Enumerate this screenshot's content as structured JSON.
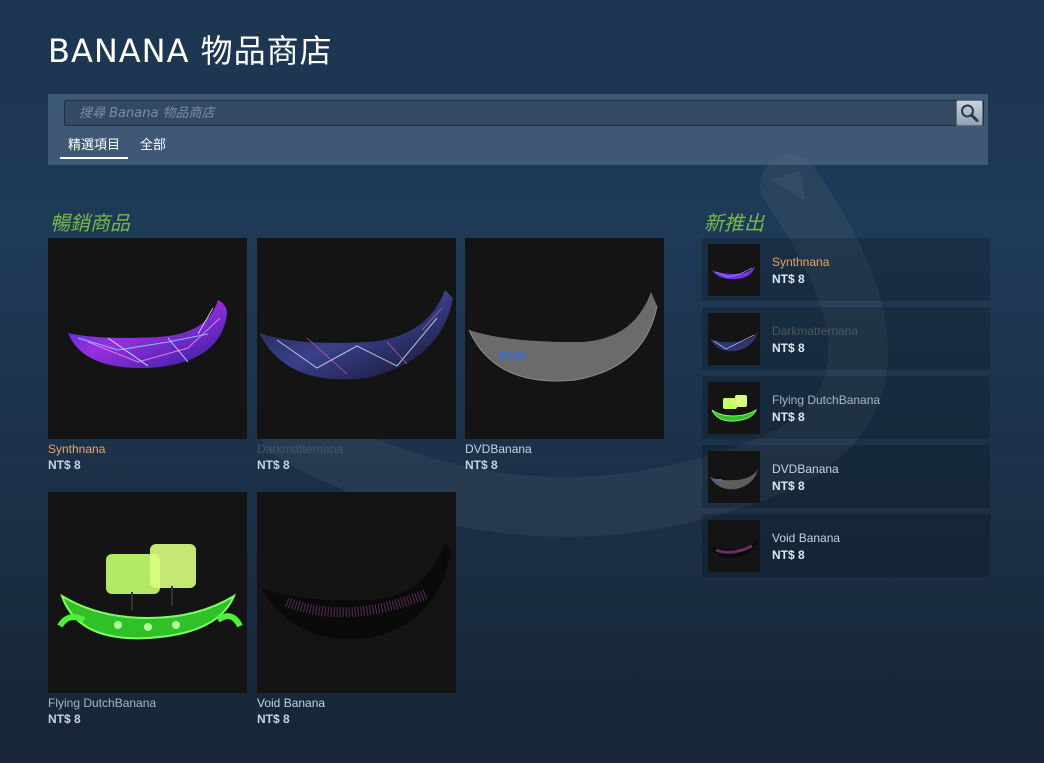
{
  "title": "BANANA 物品商店",
  "search": {
    "placeholder": "搜尋 Banana 物品商店"
  },
  "tabs": [
    {
      "label": "精選項目",
      "active": true
    },
    {
      "label": "全部",
      "active": false
    }
  ],
  "best_sellers": {
    "title": "暢銷商品",
    "items": [
      {
        "name": "Synthnana",
        "price": "NT$ 8",
        "name_color": "#e9a464",
        "icon": "synthnana-banana-image"
      },
      {
        "name": "Darkmatternana",
        "price": "NT$ 8",
        "name_color": "#4e5460",
        "icon": "darkmatternana-banana-image"
      },
      {
        "name": "DVDBanana",
        "price": "NT$ 8",
        "name_color": "#c6d4df",
        "icon": "dvd-banana-image"
      },
      {
        "name": "Flying DutchBanana",
        "price": "NT$ 8",
        "name_color": "#aab5bf",
        "icon": "flying-dutch-banana-image"
      },
      {
        "name": "Void Banana",
        "price": "NT$ 8",
        "name_color": "#bcd6ec",
        "icon": "void-banana-image"
      }
    ]
  },
  "new_releases": {
    "title": "新推出",
    "items": [
      {
        "name": "Synthnana",
        "price": "NT$ 8"
      },
      {
        "name": "Darkmatternana",
        "price": "NT$ 8"
      },
      {
        "name": "Flying DutchBanana",
        "price": "NT$ 8"
      },
      {
        "name": "DVDBanana",
        "price": "NT$ 8"
      },
      {
        "name": "Void Banana",
        "price": "NT$ 8"
      }
    ]
  },
  "colors": {
    "accent_green": "#76b84a",
    "background": "#1c3550",
    "rarity_orange": "#e9a464"
  }
}
